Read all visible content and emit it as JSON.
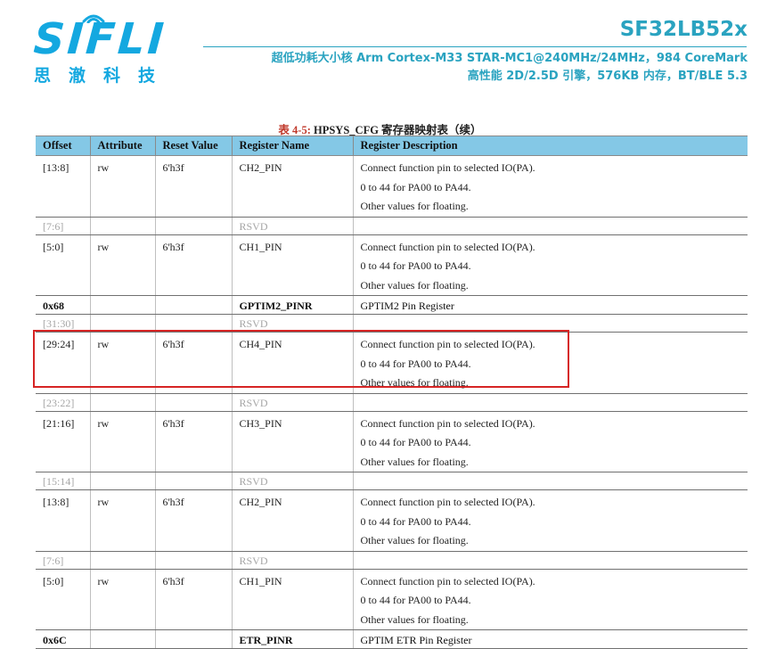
{
  "header": {
    "logo_text": "SIFLI",
    "logo_cn": "思澈科技",
    "chip_title": "SF32LB52x",
    "subtitle_line1": "超低功耗大小核 Arm Cortex-M33 STAR-MC1@240MHz/24MHz，984 CoreMark",
    "subtitle_line2": "高性能 2D/2.5D 引擎，576KB 内存，BT/BLE 5.3",
    "accent_color": "#2aa3c0",
    "logo_color": "#14a8e0"
  },
  "caption": {
    "prefix": "表 4-5:",
    "text": " HPSYS_CFG 寄存器映射表（续）"
  },
  "table": {
    "columns": [
      "Offset",
      "Attribute",
      "Reset Value",
      "Register Name",
      "Register Description"
    ],
    "header_color": "#84c8e6",
    "rows": [
      {
        "kind": "field",
        "offset": "[13:8]",
        "attr": "rw",
        "reset": "6'h3f",
        "name": "CH2_PIN",
        "desc": [
          "Connect function pin to selected IO(PA).",
          "0 to 44 for PA00 to PA44.",
          "Other values for floating."
        ]
      },
      {
        "kind": "rsvd",
        "offset": "[7:6]",
        "attr": "",
        "reset": "",
        "name": "RSVD",
        "desc": [
          ""
        ]
      },
      {
        "kind": "field",
        "offset": "[5:0]",
        "attr": "rw",
        "reset": "6'h3f",
        "name": "CH1_PIN",
        "desc": [
          "Connect function pin to selected IO(PA).",
          "0 to 44 for PA00 to PA44.",
          "Other values for floating."
        ]
      },
      {
        "kind": "reg",
        "offset": "0x68",
        "attr": "",
        "reset": "",
        "name": "GPTIM2_PINR",
        "desc": [
          "GPTIM2 Pin Register"
        ]
      },
      {
        "kind": "rsvd",
        "offset": "[31:30]",
        "attr": "",
        "reset": "",
        "name": "RSVD",
        "desc": [
          ""
        ]
      },
      {
        "kind": "field",
        "offset": "[29:24]",
        "attr": "rw",
        "reset": "6'h3f",
        "name": "CH4_PIN",
        "desc": [
          "Connect function pin to selected IO(PA).",
          "0 to 44 for PA00 to PA44.",
          "Other values for floating."
        ]
      },
      {
        "kind": "rsvd",
        "offset": "[23:22]",
        "attr": "",
        "reset": "",
        "name": "RSVD",
        "desc": [
          ""
        ]
      },
      {
        "kind": "field",
        "offset": "[21:16]",
        "attr": "rw",
        "reset": "6'h3f",
        "name": "CH3_PIN",
        "desc": [
          "Connect function pin to selected IO(PA).",
          "0 to 44 for PA00 to PA44.",
          "Other values for floating."
        ]
      },
      {
        "kind": "rsvd",
        "offset": "[15:14]",
        "attr": "",
        "reset": "",
        "name": "RSVD",
        "desc": [
          ""
        ]
      },
      {
        "kind": "field",
        "offset": "[13:8]",
        "attr": "rw",
        "reset": "6'h3f",
        "name": "CH2_PIN",
        "desc": [
          "Connect function pin to selected IO(PA).",
          "0 to 44 for PA00 to PA44.",
          "Other values for floating."
        ]
      },
      {
        "kind": "rsvd",
        "offset": "[7:6]",
        "attr": "",
        "reset": "",
        "name": "RSVD",
        "desc": [
          ""
        ]
      },
      {
        "kind": "field",
        "offset": "[5:0]",
        "attr": "rw",
        "reset": "6'h3f",
        "name": "CH1_PIN",
        "desc": [
          "Connect function pin to selected IO(PA).",
          "0 to 44 for PA00 to PA44.",
          "Other values for floating."
        ]
      },
      {
        "kind": "reg",
        "offset": "0x6C",
        "attr": "",
        "reset": "",
        "name": "ETR_PINR",
        "desc": [
          "GPTIM ETR Pin Register"
        ]
      }
    ],
    "highlight_row_index": 5,
    "highlight_color": "#d62424"
  }
}
